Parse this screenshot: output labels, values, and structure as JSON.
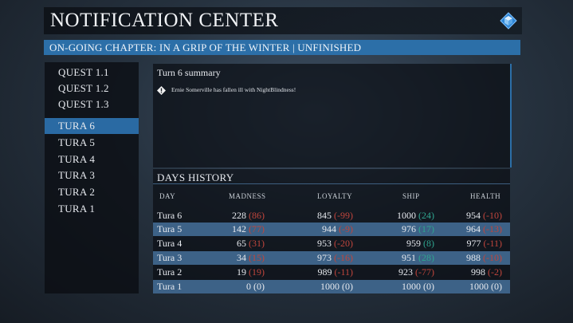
{
  "header": {
    "title": "NOTIFICATION CENTER",
    "menu_icon": "diamond-cube-icon"
  },
  "chapter": {
    "label": "ON-GOING CHAPTER: IN A GRIP OF THE WINTER | UNFINISHED"
  },
  "sidebar": {
    "items": [
      {
        "label": "QUEST 1.1",
        "active": false
      },
      {
        "label": "QUEST 1.2",
        "active": false
      },
      {
        "label": "QUEST 1.3",
        "active": false
      },
      {
        "label": "TURA 6",
        "active": true
      },
      {
        "label": "TURA 5",
        "active": false
      },
      {
        "label": "TURA 4",
        "active": false
      },
      {
        "label": "TURA 3",
        "active": false
      },
      {
        "label": "TURA 2",
        "active": false
      },
      {
        "label": "TURA 1",
        "active": false
      }
    ]
  },
  "summary": {
    "title": "Turn 6 summary",
    "notes": [
      {
        "icon": "alert-diamond-icon",
        "text": "Ernie Somerville has fallen ill with NightBlindness!"
      }
    ]
  },
  "history": {
    "title": "DAYS HISTORY",
    "columns": [
      "DAY",
      "MADNESS",
      "LOYALTY",
      "SHIP",
      "HEALTH"
    ],
    "rows": [
      {
        "day": "Tura 6",
        "madness": "228",
        "madness_delta": "(86)",
        "loyalty": "845",
        "loyalty_delta": "(-99)",
        "ship": "1000",
        "ship_delta": "(24)",
        "health": "954",
        "health_delta": "(-10)"
      },
      {
        "day": "Tura 5",
        "madness": "142",
        "madness_delta": "(77)",
        "loyalty": "944",
        "loyalty_delta": "(-9)",
        "ship": "976",
        "ship_delta": "(17)",
        "health": "964",
        "health_delta": "(-13)"
      },
      {
        "day": "Tura 4",
        "madness": "65",
        "madness_delta": "(31)",
        "loyalty": "953",
        "loyalty_delta": "(-20)",
        "ship": "959",
        "ship_delta": "(8)",
        "health": "977",
        "health_delta": "(-11)"
      },
      {
        "day": "Tura 3",
        "madness": "34",
        "madness_delta": "(15)",
        "loyalty": "973",
        "loyalty_delta": "(-16)",
        "ship": "951",
        "ship_delta": "(28)",
        "health": "988",
        "health_delta": "(-10)"
      },
      {
        "day": "Tura 2",
        "madness": "19",
        "madness_delta": "(19)",
        "loyalty": "989",
        "loyalty_delta": "(-11)",
        "ship": "923",
        "ship_delta": "(-77)",
        "health": "998",
        "health_delta": "(-2)"
      },
      {
        "day": "Tura 1",
        "madness": "0",
        "madness_delta": "(0)",
        "loyalty": "1000",
        "loyalty_delta": "(0)",
        "ship": "1000",
        "ship_delta": "(0)",
        "health": "1000",
        "health_delta": "(0)"
      }
    ]
  },
  "colors": {
    "accent": "#2c6fa8",
    "negative": "#c0453c",
    "positive": "#2fa58f"
  }
}
